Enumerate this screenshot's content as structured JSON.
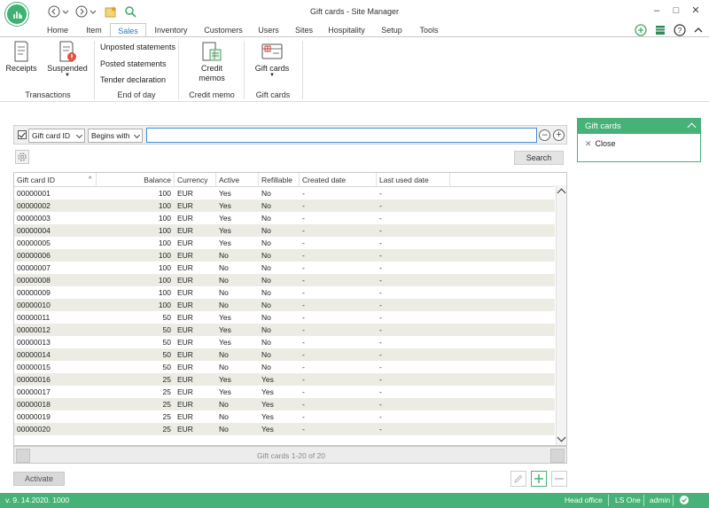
{
  "window": {
    "title": "Gift cards - Site Manager"
  },
  "tabs": [
    "Home",
    "Item",
    "Sales",
    "Inventory",
    "Customers",
    "Users",
    "Sites",
    "Hospitality",
    "Setup",
    "Tools"
  ],
  "ribbon": {
    "receipts": "Receipts",
    "suspended": "Suspended",
    "transactions_group": "Transactions",
    "unposted": "Unposted statements",
    "posted": "Posted statements",
    "tender": "Tender declaration",
    "eod_group": "End of day",
    "credit_memos": "Credit memos",
    "credit_memo_group": "Credit memo",
    "gift_cards": "Gift cards",
    "gift_cards_group": "Gift cards"
  },
  "filter": {
    "field": "Gift card ID",
    "mode": "Begins with",
    "value": "",
    "search_label": "Search"
  },
  "grid": {
    "columns": [
      "Gift card ID",
      "Balance",
      "Currency",
      "Active",
      "Refillable",
      "Created date",
      "Last used date"
    ],
    "rows": [
      [
        "00000001",
        "100",
        "EUR",
        "Yes",
        "No",
        "-",
        "-"
      ],
      [
        "00000002",
        "100",
        "EUR",
        "Yes",
        "No",
        "-",
        "-"
      ],
      [
        "00000003",
        "100",
        "EUR",
        "Yes",
        "No",
        "-",
        "-"
      ],
      [
        "00000004",
        "100",
        "EUR",
        "Yes",
        "No",
        "-",
        "-"
      ],
      [
        "00000005",
        "100",
        "EUR",
        "Yes",
        "No",
        "-",
        "-"
      ],
      [
        "00000006",
        "100",
        "EUR",
        "No",
        "No",
        "-",
        "-"
      ],
      [
        "00000007",
        "100",
        "EUR",
        "No",
        "No",
        "-",
        "-"
      ],
      [
        "00000008",
        "100",
        "EUR",
        "No",
        "No",
        "-",
        "-"
      ],
      [
        "00000009",
        "100",
        "EUR",
        "No",
        "No",
        "-",
        "-"
      ],
      [
        "00000010",
        "100",
        "EUR",
        "No",
        "No",
        "-",
        "-"
      ],
      [
        "00000011",
        "50",
        "EUR",
        "Yes",
        "No",
        "-",
        "-"
      ],
      [
        "00000012",
        "50",
        "EUR",
        "Yes",
        "No",
        "-",
        "-"
      ],
      [
        "00000013",
        "50",
        "EUR",
        "Yes",
        "No",
        "-",
        "-"
      ],
      [
        "00000014",
        "50",
        "EUR",
        "No",
        "No",
        "-",
        "-"
      ],
      [
        "00000015",
        "50",
        "EUR",
        "No",
        "No",
        "-",
        "-"
      ],
      [
        "00000016",
        "25",
        "EUR",
        "Yes",
        "Yes",
        "-",
        "-"
      ],
      [
        "00000017",
        "25",
        "EUR",
        "Yes",
        "Yes",
        "-",
        "-"
      ],
      [
        "00000018",
        "25",
        "EUR",
        "No",
        "Yes",
        "-",
        "-"
      ],
      [
        "00000019",
        "25",
        "EUR",
        "No",
        "Yes",
        "-",
        "-"
      ],
      [
        "00000020",
        "25",
        "EUR",
        "No",
        "Yes",
        "-",
        "-"
      ]
    ],
    "pager_text": "Gift cards 1-20 of 20"
  },
  "activate_label": "Activate",
  "panel": {
    "title": "Gift cards",
    "close_label": "Close"
  },
  "status": {
    "version": "v. 9. 14.2020. 1000",
    "store": "Head office",
    "product": "LS One",
    "user": "admin"
  },
  "colors": {
    "accent": "#46b277",
    "link": "#2b7bbd"
  }
}
